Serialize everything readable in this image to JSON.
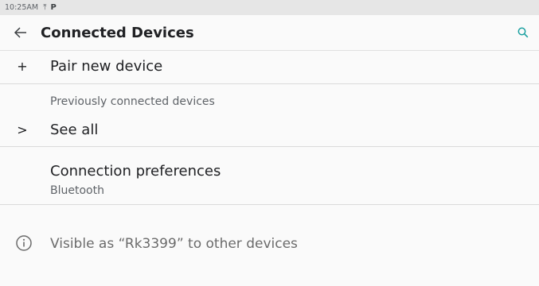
{
  "status_bar": {
    "time": "10:25AM",
    "icons": [
      "upload-icon",
      "parking-icon"
    ],
    "parking_glyph": "P"
  },
  "app_bar": {
    "back_icon": "arrow-back-icon",
    "title": "Connected Devices",
    "search_icon": "search-icon",
    "accent_color": "#1aa0a0"
  },
  "pair_new_device": {
    "icon": "plus-icon",
    "icon_glyph": "+",
    "label": "Pair new device"
  },
  "previously_connected": {
    "section_label": "Previously connected devices",
    "see_all": {
      "icon": "chevron-right-icon",
      "icon_glyph": ">",
      "label": "See all"
    }
  },
  "connection_preferences": {
    "label": "Connection preferences",
    "subtitle": "Bluetooth"
  },
  "visibility_info": {
    "icon": "info-icon",
    "text": "Visible as “Rk3399” to other devices"
  }
}
